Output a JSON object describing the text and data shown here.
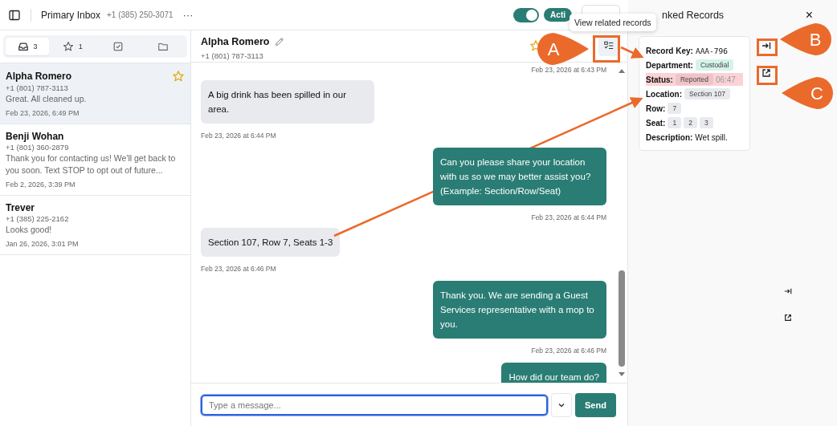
{
  "topbar": {
    "inbox_title": "Primary Inbox",
    "inbox_phone": "+1 (385) 250-3071",
    "more": "···",
    "toggle": {
      "on": true
    },
    "status_badge": "Acti"
  },
  "tooltip": "View related records",
  "tabs": [
    {
      "kind": "inbox",
      "count": "3",
      "selected": true
    },
    {
      "kind": "starred",
      "count": "1",
      "selected": false
    },
    {
      "kind": "tasks",
      "selected": false
    },
    {
      "kind": "archive",
      "selected": false
    }
  ],
  "conversations": [
    {
      "name": "Alpha Romero",
      "phone": "+1 (801) 787-3113",
      "preview": "Great. All cleaned up.",
      "time": "Feb 23, 2026, 6:49 PM",
      "selected": true,
      "starred": true
    },
    {
      "name": "Benji Wohan",
      "phone": "+1 (801) 360-2879",
      "preview": "Thank you for contacting us! We'll get back to you soon. Text STOP to opt out of future...",
      "time": "Feb 2, 2026, 3:39 PM",
      "selected": false,
      "starred": false
    },
    {
      "name": "Trever",
      "phone": "+1 (385) 225-2162",
      "preview": "Looks good!",
      "time": "Jan 26, 2026, 3:01 PM",
      "selected": false,
      "starred": false
    }
  ],
  "chat": {
    "name": "Alpha Romero",
    "phone": "+1 (801) 787-3113",
    "starred": true,
    "top_time": "Feb 23, 2026 at 6:43 PM",
    "messages": [
      {
        "kind": "incoming",
        "text": "A big drink has been spilled in our area.",
        "time": "Feb 23, 2026 at 6:44 PM"
      },
      {
        "kind": "outgoing",
        "text": "Can you please share your location with us so we may better assist you? (Example: Section/Row/Seat)",
        "time": "Feb 23, 2026 at 6:44 PM"
      },
      {
        "kind": "incoming",
        "text": "Section 107, Row 7, Seats 1-3",
        "time": "Feb 23, 2026 at 6:46 PM"
      },
      {
        "kind": "outgoing",
        "text": "Thank you. We are sending a Guest Services representative  with a mop to you.",
        "time": "Feb 23, 2026 at 6:46 PM"
      },
      {
        "kind": "outgoing",
        "text": "How did our team do?"
      }
    ]
  },
  "composer": {
    "placeholder": "Type a message...",
    "send": "Send"
  },
  "panel": {
    "title": "nked Records",
    "close": "×",
    "fields": [
      {
        "label": "Record Key:",
        "kind": "code",
        "value": "AAA-796"
      },
      {
        "label": "Department:",
        "kind": "tag",
        "values": [
          "Custodial"
        ],
        "color": "#d5f3ea"
      },
      {
        "label": "Status:",
        "kind": "tag",
        "values": [
          "Reported"
        ],
        "color": "#efc3c7",
        "extra": "06:47",
        "highlighted": true
      },
      {
        "label": "Location:",
        "kind": "tag",
        "values": [
          "Section 107"
        ],
        "color": "#e8eaee"
      },
      {
        "label": "Row:",
        "kind": "tag",
        "values": [
          "7"
        ],
        "color": "#e8eaee"
      },
      {
        "label": "Seat:",
        "kind": "tag",
        "values": [
          "1",
          "2",
          "3"
        ],
        "color": "#e8eaee"
      },
      {
        "label": "Description:",
        "kind": "text",
        "value": "Wet spill."
      }
    ]
  },
  "callouts": [
    {
      "letter": "A"
    },
    {
      "letter": "B"
    },
    {
      "letter": "C"
    }
  ]
}
